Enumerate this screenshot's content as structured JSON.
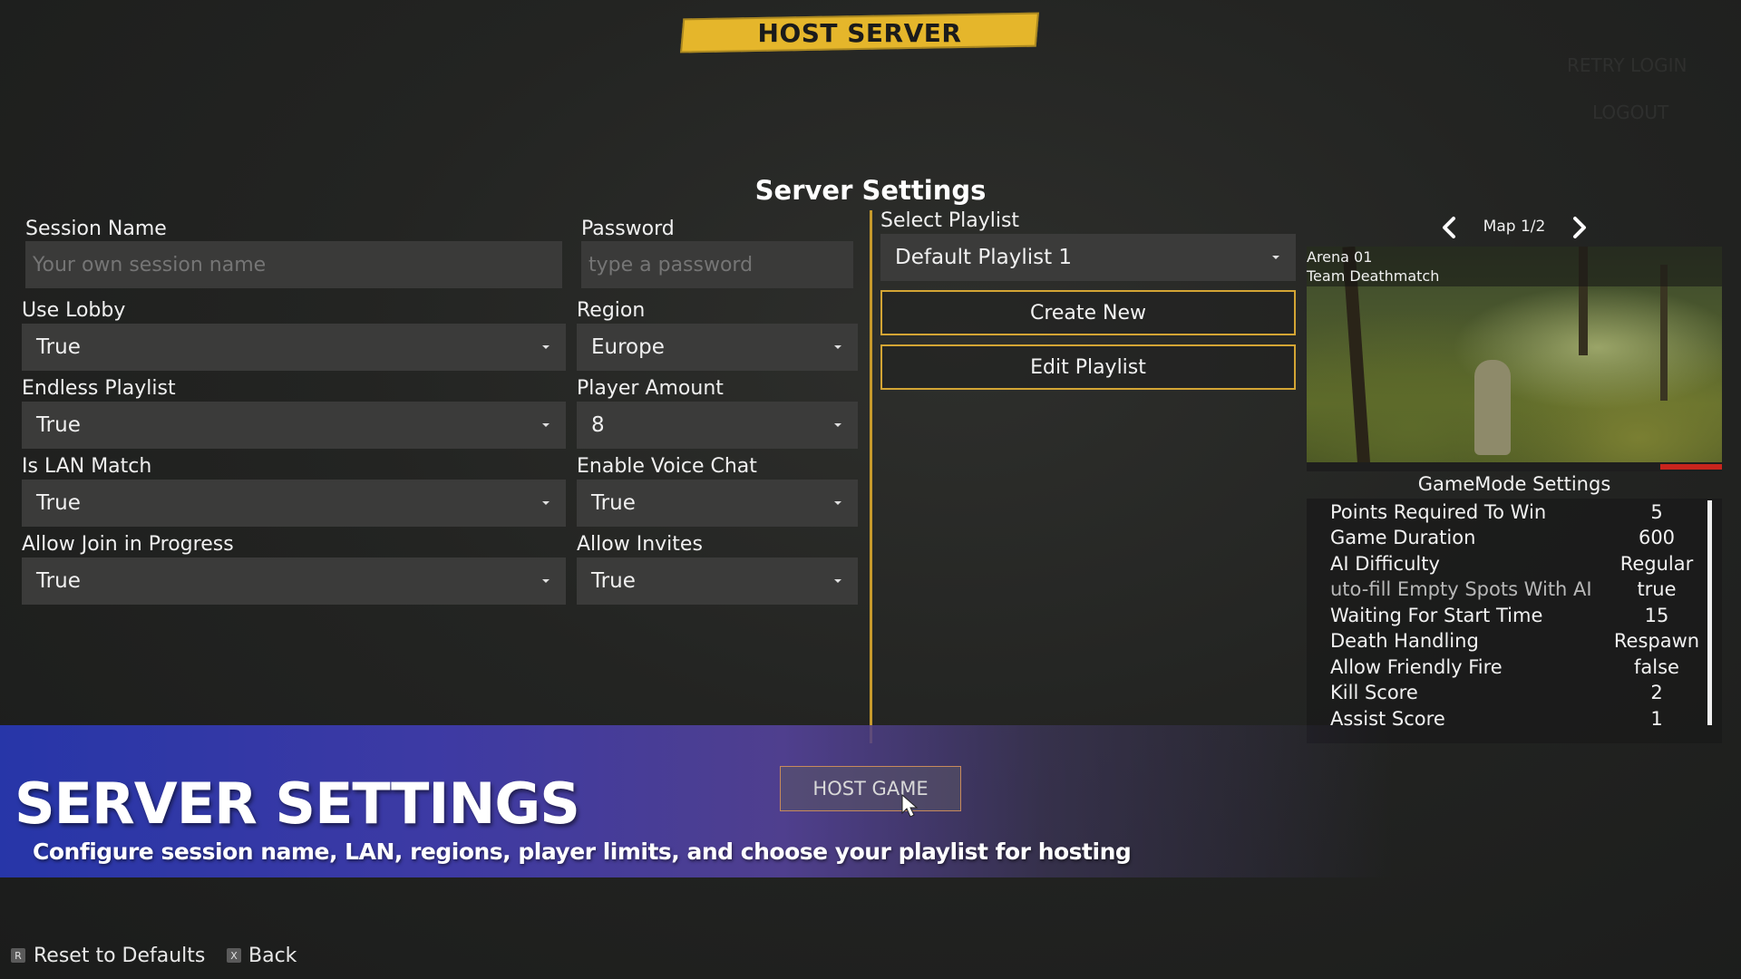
{
  "header": {
    "banner": "HOST SERVER"
  },
  "top_right": {
    "retry_login": "RETRY LOGIN",
    "logout": "LOGOUT"
  },
  "settings_title": "Server Settings",
  "left_fields": {
    "session_name": {
      "label": "Session Name",
      "placeholder": "Your own session name"
    },
    "password": {
      "label": "Password",
      "placeholder": "type a password"
    },
    "use_lobby": {
      "label": "Use Lobby",
      "value": "True"
    },
    "region": {
      "label": "Region",
      "value": "Europe"
    },
    "endless_playlist": {
      "label": "Endless Playlist",
      "value": "True"
    },
    "player_amount": {
      "label": "Player Amount",
      "value": "8"
    },
    "is_lan_match": {
      "label": "Is LAN Match",
      "value": "True"
    },
    "enable_voice_chat": {
      "label": "Enable Voice Chat",
      "value": "True"
    },
    "allow_join_in_progress": {
      "label": "Allow Join in Progress",
      "value": "True"
    },
    "allow_invites": {
      "label": "Allow Invites",
      "value": "True"
    }
  },
  "playlist": {
    "label": "Select Playlist",
    "selected": "Default Playlist 1",
    "create_new": "Create New",
    "edit_playlist": "Edit Playlist"
  },
  "map": {
    "pager": "Map 1/2",
    "name": "Arena 01",
    "mode": "Team Deathmatch"
  },
  "gamemode": {
    "title": "GameMode Settings",
    "rows": [
      {
        "key": "Points Required To Win",
        "value": "5"
      },
      {
        "key": "Game Duration",
        "value": "600"
      },
      {
        "key": "AI Difficulty",
        "value": "Regular"
      },
      {
        "key": "uto-fill Empty Spots With AI",
        "value": "true"
      },
      {
        "key": "Waiting For Start Time",
        "value": "15"
      },
      {
        "key": "Death Handling",
        "value": "Respawn"
      },
      {
        "key": "Allow Friendly Fire",
        "value": "false"
      },
      {
        "key": "Kill Score",
        "value": "2"
      },
      {
        "key": "Assist Score",
        "value": "1"
      }
    ]
  },
  "hero": {
    "title": "SERVER SETTINGS",
    "subtitle": "Configure session name, LAN, regions, player limits, and choose your playlist for hosting"
  },
  "host_game": "HOST GAME",
  "footer": {
    "reset_key": "R",
    "reset_label": "Reset to Defaults",
    "back_key": "X",
    "back_label": "Back"
  },
  "colors": {
    "accent": "#e5b62b",
    "outline": "#d4a534",
    "hero_blue": "#2736a8"
  }
}
